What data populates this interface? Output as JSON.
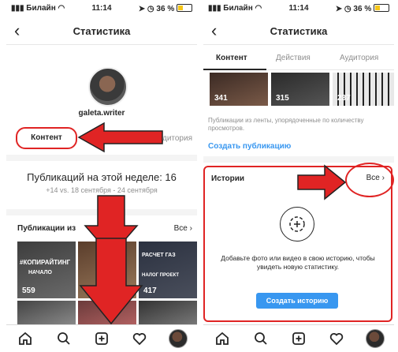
{
  "status": {
    "carrier": "Билайн",
    "time": "11:14",
    "battery": "36 %"
  },
  "header": {
    "back": "‹",
    "title": "Статистика"
  },
  "profile": {
    "username": "galeta.writer",
    "tab_content": "Контент",
    "tab_audience_partial": "удитория"
  },
  "week": {
    "title": "Публикаций на этой неделе: 16",
    "subtitle": "+14 vs. 18 сентября - 24 сентября"
  },
  "publications": {
    "title": "Публикации из",
    "all": "Все",
    "tiles": [
      {
        "caption": "#КОПИРАЙТИНГ",
        "sub": "НАЧАЛО",
        "count": "559"
      },
      {
        "caption": "",
        "sub": "",
        "count": ""
      },
      {
        "caption": "РАСЧЕТ ГАЗ",
        "sub": "НАЛОГ ПРОЕКТ",
        "count": "417"
      }
    ]
  },
  "tabs2": {
    "content": "Контент",
    "actions": "Действия",
    "audience": "Аудитория"
  },
  "grid2": [
    "341",
    "315",
    "237"
  ],
  "note2": "Публикации из ленты, упорядоченные по количеству просмотров.",
  "create_publication": "Создать публикацию",
  "stories": {
    "title": "Истории",
    "all": "Все",
    "text": "Добавьте фото или видео в свою историю, чтобы увидеть новую статистику.",
    "button": "Создать историю"
  },
  "colors": {
    "accent_red": "#e02424",
    "link_blue": "#3897f0"
  }
}
